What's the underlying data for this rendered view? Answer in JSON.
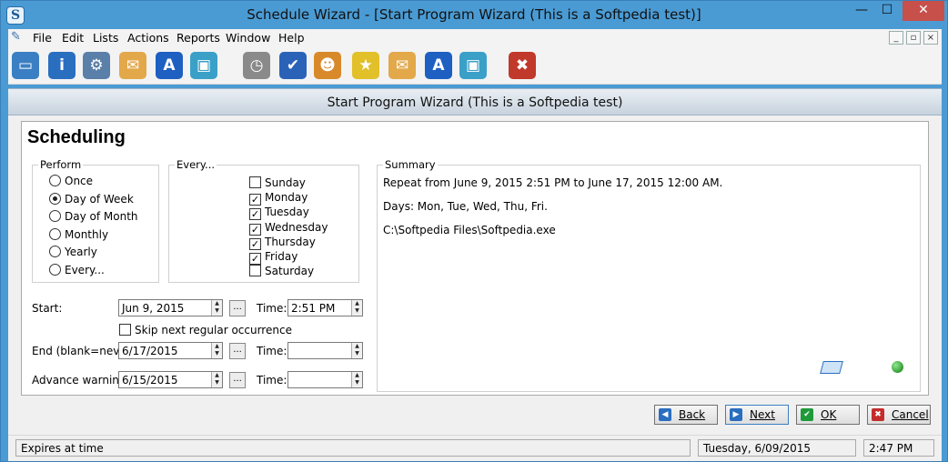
{
  "window": {
    "title": "Schedule Wizard - [Start Program Wizard  (This is a Softpedia test)]",
    "app_icon": "S",
    "controls": {
      "minimize": "—",
      "maximize": "☐",
      "close": "✕"
    }
  },
  "menu": {
    "items": [
      "File",
      "Edit",
      "Lists",
      "Actions",
      "Reports",
      "Window",
      "Help"
    ],
    "mdi_minimize": "_",
    "mdi_restore": "▫",
    "mdi_close": "×"
  },
  "toolbar": {
    "icons": [
      {
        "name": "new-schedule-icon",
        "glyph": "▭",
        "color": "#3a7fc4"
      },
      {
        "name": "info-icon",
        "glyph": "i",
        "color": "#2a6ec0"
      },
      {
        "name": "settings-gear-icon",
        "glyph": "⚙",
        "color": "#5a7fa8"
      },
      {
        "name": "add-email-icon",
        "glyph": "✉",
        "color": "#e2a84a"
      },
      {
        "name": "add-text-icon",
        "glyph": "A",
        "color": "#1e5fc2"
      },
      {
        "name": "add-computer-icon",
        "glyph": "▣",
        "color": "#3aa0c8"
      },
      {
        "name": "clock-icon",
        "glyph": "◷",
        "color": "#8a8a8a"
      },
      {
        "name": "checklist-icon",
        "glyph": "✔",
        "color": "#2a62b8"
      },
      {
        "name": "users-icon",
        "glyph": "☻",
        "color": "#d88a2a"
      },
      {
        "name": "star-icon",
        "glyph": "★",
        "color": "#e2c02a"
      },
      {
        "name": "email-icon",
        "glyph": "✉",
        "color": "#e2a84a"
      },
      {
        "name": "text-icon",
        "glyph": "A",
        "color": "#1e5fc2"
      },
      {
        "name": "computer-icon",
        "glyph": "▣",
        "color": "#3aa0c8"
      },
      {
        "name": "tools-icon",
        "glyph": "✖",
        "color": "#c0392b"
      }
    ]
  },
  "wizard": {
    "header": "Start Program Wizard  (This is a Softpedia test)",
    "heading": "Scheduling",
    "perform": {
      "title": "Perform",
      "options": [
        {
          "label": "Once",
          "selected": false
        },
        {
          "label": "Day of Week",
          "selected": true
        },
        {
          "label": "Day of Month",
          "selected": false
        },
        {
          "label": "Monthly",
          "selected": false
        },
        {
          "label": "Yearly",
          "selected": false
        },
        {
          "label": "Every...",
          "selected": false
        }
      ]
    },
    "every": {
      "title": "Every...",
      "days": [
        {
          "label": "Sunday",
          "checked": false
        },
        {
          "label": "Monday",
          "checked": true
        },
        {
          "label": "Tuesday",
          "checked": true
        },
        {
          "label": "Wednesday",
          "checked": true
        },
        {
          "label": "Thursday",
          "checked": true
        },
        {
          "label": "Friday",
          "checked": true
        },
        {
          "label": "Saturday",
          "checked": false
        }
      ]
    },
    "start": {
      "label": "Start:",
      "date": "Jun 9, 2015",
      "time_label": "Time:",
      "time": "2:51 PM"
    },
    "skip": {
      "label": "Skip next regular occurrence",
      "checked": false
    },
    "end": {
      "label": "End (blank=never):",
      "date": "6/17/2015",
      "time_label": "Time:",
      "time": ""
    },
    "advance": {
      "label": "Advance warning:",
      "date": "6/15/2015",
      "time_label": "Time:",
      "time": ""
    },
    "dots": "...",
    "summary": {
      "title": "Summary",
      "lines": [
        "Repeat from June  9, 2015 2:51 PM to June 17, 2015 12:00 AM.",
        "Days: Mon, Tue, Wed, Thu, Fri.",
        "C:\\Softpedia Files\\Softpedia.exe"
      ]
    },
    "buttons": {
      "back": "Back",
      "next": "Next",
      "ok": "OK",
      "cancel": "Cancel"
    },
    "button_glyphs": {
      "back": "◀",
      "next": "▶",
      "ok": "✔",
      "cancel": "✖"
    }
  },
  "status": {
    "message": "Expires at time",
    "date": "Tuesday,  6/09/2015",
    "time": "2:47 PM"
  }
}
